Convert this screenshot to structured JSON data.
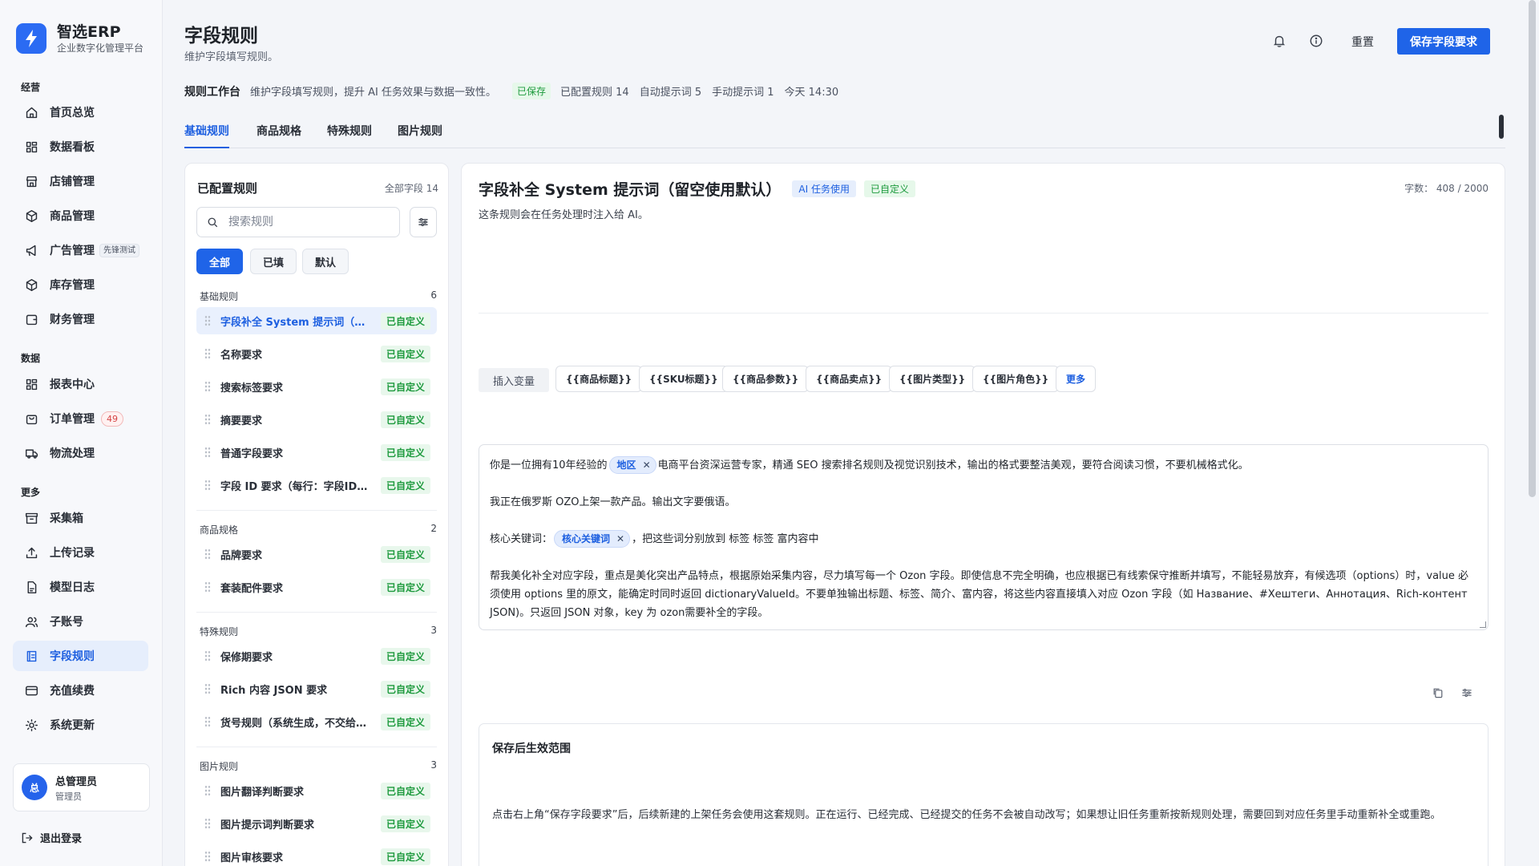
{
  "brand": {
    "name": "智选ERP",
    "subtitle": "企业数字化管理平台"
  },
  "sidebar": {
    "groups": [
      {
        "label": "经营"
      },
      {
        "label": "数据"
      },
      {
        "label": "更多"
      }
    ],
    "items": [
      {
        "label": "首页总览",
        "icon": "home-icon"
      },
      {
        "label": "数据看板",
        "icon": "grid-icon"
      },
      {
        "label": "店铺管理",
        "icon": "store-icon"
      },
      {
        "label": "商品管理",
        "icon": "box-icon"
      },
      {
        "label": "广告管理",
        "icon": "megaphone-icon",
        "badge": "先锋测试"
      },
      {
        "label": "库存管理",
        "icon": "box-icon"
      },
      {
        "label": "财务管理",
        "icon": "wallet-icon"
      },
      {
        "label": "报表中心",
        "icon": "grid-icon"
      },
      {
        "label": "订单管理",
        "icon": "bag-icon",
        "count": "49"
      },
      {
        "label": "物流处理",
        "icon": "truck-icon"
      },
      {
        "label": "采集箱",
        "icon": "archive-icon"
      },
      {
        "label": "上传记录",
        "icon": "upload-icon"
      },
      {
        "label": "模型日志",
        "icon": "file-icon"
      },
      {
        "label": "子账号",
        "icon": "users-icon"
      },
      {
        "label": "字段规则",
        "icon": "rules-icon",
        "active": true
      },
      {
        "label": "充值续费",
        "icon": "card-icon"
      },
      {
        "label": "系统更新",
        "icon": "gear-icon"
      }
    ]
  },
  "user": {
    "avatar": "总",
    "name": "总管理员",
    "role": "管理员"
  },
  "logout": "退出登录",
  "header": {
    "title": "字段规则",
    "subtitle": "维护字段填写规则。",
    "reset": "重置",
    "save": "保存字段要求"
  },
  "workbench": {
    "title": "规则工作台",
    "desc": "维护字段填写规则，提升 AI 任务效果与数据一致性。",
    "status": "已保存",
    "configured": "已配置规则 14",
    "auto": "自动提示词 5",
    "manual": "手动提示词 1",
    "time": "今天 14:30"
  },
  "tabs": [
    "基础规则",
    "商品规格",
    "特殊规则",
    "图片规则"
  ],
  "left_panel": {
    "title": "已配置规则",
    "count": "全部字段 14",
    "search_placeholder": "搜索规则",
    "filters": [
      "全部",
      "已填",
      "默认"
    ],
    "groups": [
      {
        "name": "基础规则",
        "count": "6",
        "rules": [
          {
            "name": "字段补全 System 提示词（留空使用默认）",
            "tag": "已自定义"
          },
          {
            "name": "名称要求",
            "tag": "已自定义"
          },
          {
            "name": "搜索标签要求",
            "tag": "已自定义"
          },
          {
            "name": "摘要要求",
            "tag": "已自定义"
          },
          {
            "name": "普通字段要求",
            "tag": "已自定义"
          },
          {
            "name": "字段 ID 要求（每行：字段ID=要求）",
            "tag": "已自定义"
          }
        ]
      },
      {
        "name": "商品规格",
        "count": "2",
        "rules": [
          {
            "name": "品牌要求",
            "tag": "已自定义"
          },
          {
            "name": "套装配件要求",
            "tag": "已自定义"
          }
        ]
      },
      {
        "name": "特殊规则",
        "count": "3",
        "rules": [
          {
            "name": "保修期要求",
            "tag": "已自定义"
          },
          {
            "name": "Rich 内容 JSON 要求",
            "tag": "已自定义"
          },
          {
            "name": "货号规则（系统生成，不交给AI）",
            "tag": "已自定义"
          }
        ]
      },
      {
        "name": "图片规则",
        "count": "3",
        "rules": [
          {
            "name": "图片翻译判断要求",
            "tag": "已自定义"
          },
          {
            "name": "图片提示词判断要求",
            "tag": "已自定义"
          },
          {
            "name": "图片审核要求",
            "tag": "已自定义"
          }
        ]
      }
    ]
  },
  "editor_panel": {
    "title": "字段补全 System 提示词（留空使用默认）",
    "badge_ai": "AI 任务使用",
    "badge_custom": "已自定义",
    "char_count": "字数： 408 / 2000",
    "desc": "这条规则会在任务处理时注入给 AI。",
    "insert_label": "插入变量",
    "variables": [
      "{{商品标题}}",
      "{{SKU标题}}",
      "{{商品参数}}",
      "{{商品卖点}}",
      "{{图片类型}}",
      "{{图片角色}}"
    ],
    "more": "更多",
    "content": {
      "l1_a": "你是一位拥有10年经验的",
      "chip_region": "地区",
      "l1_b": "电商平台资深运营专家，精通 SEO 搜索排名规则及视觉识别技术，输出的格式要整洁美观，要符合阅读习惯，不要机械格式化。",
      "l2": "我正在俄罗斯 OZO上架一款产品。输出文字要俄语。",
      "l3_a": "核心关键词：",
      "chip_keyword": "核心关键词",
      "l3_b": "，把这些词分别放到 标签 标签 富内容中",
      "l4": "帮我美化补全对应字段，重点是美化突出产品特点，根据原始采集内容，尽力填写每一个 Ozon 字段。即使信息不完全明确，也应根据已有线索保守推断并填写，不能轻易放弃，有候选项（options）时，value 必须使用 options 里的原文，能确定时同时返回 dictionaryValueId。不要单独输出标题、标签、简介、富内容，将这些内容直接填入对应 Ozon 字段（如 Название、#Хештеги、Аннотация、Rich-контент JSON)。只返回 JSON 对象，key 为 ozon需要补全的字段。"
    },
    "scope_title": "保存后生效范围",
    "scope_text": "点击右上角“保存字段要求”后，后续新建的上架任务会使用这套规则。正在运行、已经完成、已经提交的任务不会被自动改写；如果想让旧任务重新按新规则处理，需要回到对应任务里手动重新补全或重跑。"
  },
  "colors": {
    "accent": "#1f64e8",
    "success": "#1d9a3d",
    "success_bg": "#e8f7ec"
  }
}
